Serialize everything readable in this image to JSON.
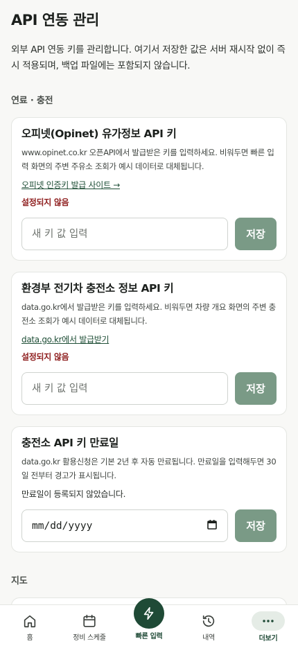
{
  "page": {
    "title": "API 연동 관리",
    "description": "외부 API 연동 키를 관리합니다. 여기서 저장한 값은 서버 재시작 없이 즉시 적용되며, 백업 파일에는 포함되지 않습니다."
  },
  "sections": {
    "fuel": {
      "title": "연료 · 충전",
      "opinet": {
        "title": "오피넷(Opinet) 유가정보 API 키",
        "description": "www.opinet.co.kr 오픈API에서 발급받은 키를 입력하세요. 비워두면 빠른 입력 화면의 주변 주유소 조회가 예시 데이터로 대체됩니다.",
        "link": "오피넷 인증키 발급 사이트 →",
        "status": "설정되지 않음",
        "placeholder": "새 키 값 입력",
        "save_label": "저장"
      },
      "ev": {
        "title": "환경부 전기차 충전소 정보 API 키",
        "description": "data.go.kr에서 발급받은 키를 입력하세요. 비워두면 차량 개요 화면의 주변 충전소 조회가 예시 데이터로 대체됩니다.",
        "link": "data.go.kr에서 발급받기",
        "status": "설정되지 않음",
        "placeholder": "새 키 값 입력",
        "save_label": "저장"
      },
      "expiry": {
        "title": "충전소 API 키 만료일",
        "description": "data.go.kr 활용신청은 기본 2년 후 자동 만료됩니다. 만료일을 입력해두면 30일 전부터 경고가 표시됩니다.",
        "info": "만료일이 등록되지 않았습니다.",
        "date_placeholder": "mm/dd/yyyy",
        "save_label": "저장"
      }
    },
    "map": {
      "title": "지도"
    }
  },
  "bottom_nav": {
    "home": "홈",
    "schedule": "정비 스케줄",
    "quick": "빠른 입력",
    "history": "내역",
    "more": "더보기"
  },
  "colors": {
    "accent": "#1f4a36",
    "save_button": "#7a9a86",
    "status_warning": "#8e1d1d"
  }
}
